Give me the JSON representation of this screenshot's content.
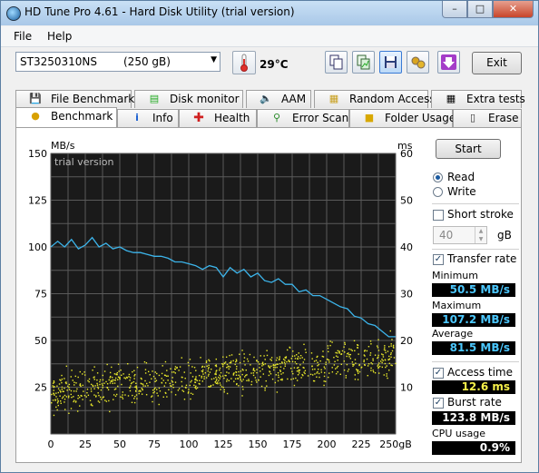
{
  "window": {
    "title": "HD Tune Pro 4.61 - Hard Disk Utility (trial version)"
  },
  "menu": {
    "file": "File",
    "help": "Help"
  },
  "toolbar": {
    "drive_name": "ST3250310NS",
    "drive_size": "(250 gB)",
    "temperature": "29°C",
    "exit_label": "Exit",
    "buttons": [
      "copy-icon",
      "copy-chart-icon",
      "save-icon",
      "options-icon",
      "download-icon"
    ]
  },
  "tabs_top": [
    "File Benchmark",
    "Disk monitor",
    "AAM",
    "Random Access",
    "Extra tests"
  ],
  "tabs_bottom": [
    "Benchmark",
    "Info",
    "Health",
    "Error Scan",
    "Folder Usage",
    "Erase"
  ],
  "controls": {
    "start_label": "Start",
    "read_label": "Read",
    "write_label": "Write",
    "short_stroke_label": "Short stroke",
    "short_stroke_value": "40",
    "short_stroke_unit": "gB",
    "transfer_rate_label": "Transfer rate",
    "access_time_label": "Access time",
    "burst_rate_label": "Burst rate",
    "mode": "read"
  },
  "stats": {
    "minimum_label": "Minimum",
    "minimum": "50.5 MB/s",
    "maximum_label": "Maximum",
    "maximum": "107.2 MB/s",
    "average_label": "Average",
    "average": "81.5 MB/s",
    "access_time": "12.6 ms",
    "burst_rate": "123.8 MB/s",
    "cpu_label": "CPU usage",
    "cpu": "0.9%"
  },
  "chart_data": {
    "type": "line",
    "watermark": "trial version",
    "ylabel_left": "MB/s",
    "ylabel_right": "ms",
    "yticks_left": [
      "25",
      "50",
      "75",
      "100",
      "125",
      "150"
    ],
    "yticks_right": [
      "10",
      "20",
      "30",
      "40",
      "50",
      "60"
    ],
    "xticks": [
      "0",
      "25",
      "50",
      "75",
      "100",
      "125",
      "150",
      "175",
      "200",
      "225",
      "250gB"
    ],
    "xlim": [
      0,
      250
    ],
    "ylim_left": [
      0,
      150
    ],
    "ylim_right": [
      0,
      60
    ],
    "series": [
      {
        "name": "Transfer rate",
        "color": "#3cb4ea",
        "axis": "left",
        "x": [
          0,
          5,
          10,
          15,
          20,
          25,
          30,
          35,
          40,
          45,
          50,
          55,
          60,
          65,
          70,
          75,
          80,
          85,
          90,
          95,
          100,
          105,
          110,
          115,
          120,
          125,
          130,
          135,
          140,
          145,
          150,
          155,
          160,
          165,
          170,
          175,
          180,
          185,
          190,
          195,
          200,
          205,
          210,
          215,
          220,
          225,
          230,
          235,
          240,
          245,
          250
        ],
        "y": [
          100,
          103,
          100,
          104,
          99,
          101,
          105,
          100,
          102,
          99,
          100,
          98,
          97,
          97,
          96,
          95,
          95,
          94,
          92,
          92,
          91,
          90,
          88,
          90,
          89,
          84,
          89,
          86,
          88,
          84,
          86,
          82,
          81,
          83,
          80,
          80,
          76,
          77,
          74,
          74,
          72,
          70,
          68,
          67,
          63,
          62,
          59,
          58,
          55,
          52,
          52
        ]
      },
      {
        "name": "Access time",
        "color": "#ecec2a",
        "axis": "right",
        "style": "scatter",
        "x_range": [
          0,
          250
        ],
        "y_trend_start": 9,
        "y_trend_end": 17,
        "y_spread": 6,
        "count": 900
      }
    ]
  }
}
